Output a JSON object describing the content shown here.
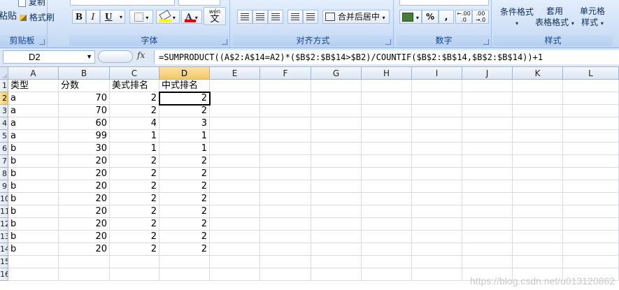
{
  "ribbon": {
    "clipboard": {
      "paste_label": "粘贴",
      "copy_label": "复制",
      "format_painter_label": "格式刷",
      "group_label": "剪贴板"
    },
    "font": {
      "bold_label": "B",
      "italic_label": "I",
      "underline_label": "U",
      "font_color_label": "A",
      "wen_label": "wén",
      "wen_char": "文",
      "group_label": "字体"
    },
    "alignment": {
      "merge_center_label": "合并后居中",
      "group_label": "对齐方式"
    },
    "number": {
      "percent_label": "%",
      "comma_label": ",",
      "inc_decimal_label": "←.00 .0",
      "dec_decimal_label": ".00 →.0",
      "group_label": "数字"
    },
    "styles": {
      "conditional_format_label": "条件格式",
      "table_format_label_1": "套用",
      "table_format_label_2": "表格格式",
      "cell_style_label_1": "单元格",
      "cell_style_label_2": "样式",
      "group_label": "样式"
    },
    "colors": {
      "highlight": "#ffff00",
      "font_color": "#e00000"
    }
  },
  "formula_bar": {
    "name_box": "D2",
    "fx_label": "fx",
    "formula": "=SUMPRODUCT((A$2:A$14=A2)*($B$2:$B$14>$B2)/COUNTIF($B$2:$B$14,$B$2:$B$14))+1"
  },
  "sheet": {
    "columns": [
      "A",
      "B",
      "C",
      "D",
      "E",
      "F",
      "G",
      "H",
      "I",
      "J",
      "K",
      "L"
    ],
    "selected_column": "D",
    "row_numbers": [
      "1",
      "2",
      "3",
      "4",
      "5",
      "6",
      "7",
      "8",
      "9",
      "10",
      "11",
      "12",
      "13",
      "14",
      "15",
      "16"
    ],
    "selected_row": "2",
    "selected_cell": "D2",
    "header_row": [
      "类型",
      "分数",
      "美式排名",
      "中式排名"
    ],
    "rows": [
      [
        "a",
        "70",
        "2",
        "2"
      ],
      [
        "a",
        "70",
        "2",
        "2"
      ],
      [
        "a",
        "60",
        "4",
        "3"
      ],
      [
        "a",
        "99",
        "1",
        "1"
      ],
      [
        "b",
        "30",
        "1",
        "1"
      ],
      [
        "b",
        "20",
        "2",
        "2"
      ],
      [
        "b",
        "20",
        "2",
        "2"
      ],
      [
        "b",
        "20",
        "2",
        "2"
      ],
      [
        "b",
        "20",
        "2",
        "2"
      ],
      [
        "b",
        "20",
        "2",
        "2"
      ],
      [
        "b",
        "20",
        "2",
        "2"
      ],
      [
        "b",
        "20",
        "2",
        "2"
      ],
      [
        "b",
        "20",
        "2",
        "2"
      ]
    ]
  },
  "watermark": "https://blog.csdn.net/u013120862"
}
